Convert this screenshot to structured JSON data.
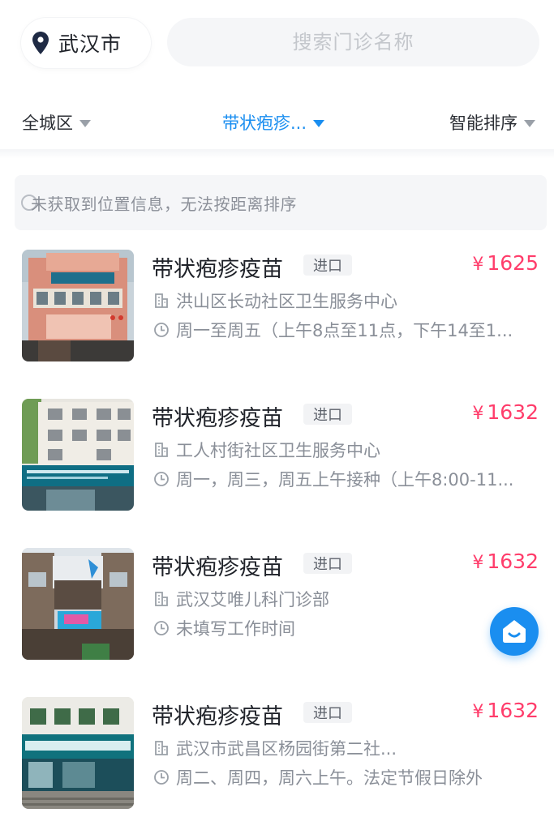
{
  "header": {
    "city": "武汉市",
    "search_placeholder": "搜索门诊名称"
  },
  "filters": {
    "area": "全城区",
    "vaccine": "带状疱疹...",
    "sort": "智能排序"
  },
  "notice": "未获取到位置信息，无法按距离排序",
  "colors": {
    "accent": "#1a8ef0",
    "price": "#ff3d6b",
    "muted": "#8a8f98"
  },
  "items": [
    {
      "title": "带状疱疹疫苗",
      "badge": "进口",
      "price_symbol": "¥",
      "price": "1625",
      "clinic": "洪山区长动社区卫生服务中心",
      "hours": "周一至周五（上午8点至11点，下午14至1..."
    },
    {
      "title": "带状疱疹疫苗",
      "badge": "进口",
      "price_symbol": "¥",
      "price": "1632",
      "clinic": "工人村街社区卫生服务中心",
      "hours": "周一，周三，周五上午接种（上午8:00-11..."
    },
    {
      "title": "带状疱疹疫苗",
      "badge": "进口",
      "price_symbol": "¥",
      "price": "1632",
      "clinic": "武汉艾唯儿科门诊部",
      "hours": "未填写工作时间"
    },
    {
      "title": "带状疱疹疫苗",
      "badge": "进口",
      "price_symbol": "¥",
      "price": "1632",
      "clinic": "武汉市武昌区杨园街第二社...",
      "hours": "周二、周四，周六上午。法定节假日除外"
    }
  ],
  "icons": {
    "location": "location-pin-icon",
    "info": "info-icon",
    "building": "building-icon",
    "clock": "clock-icon",
    "service": "customer-service-icon"
  }
}
